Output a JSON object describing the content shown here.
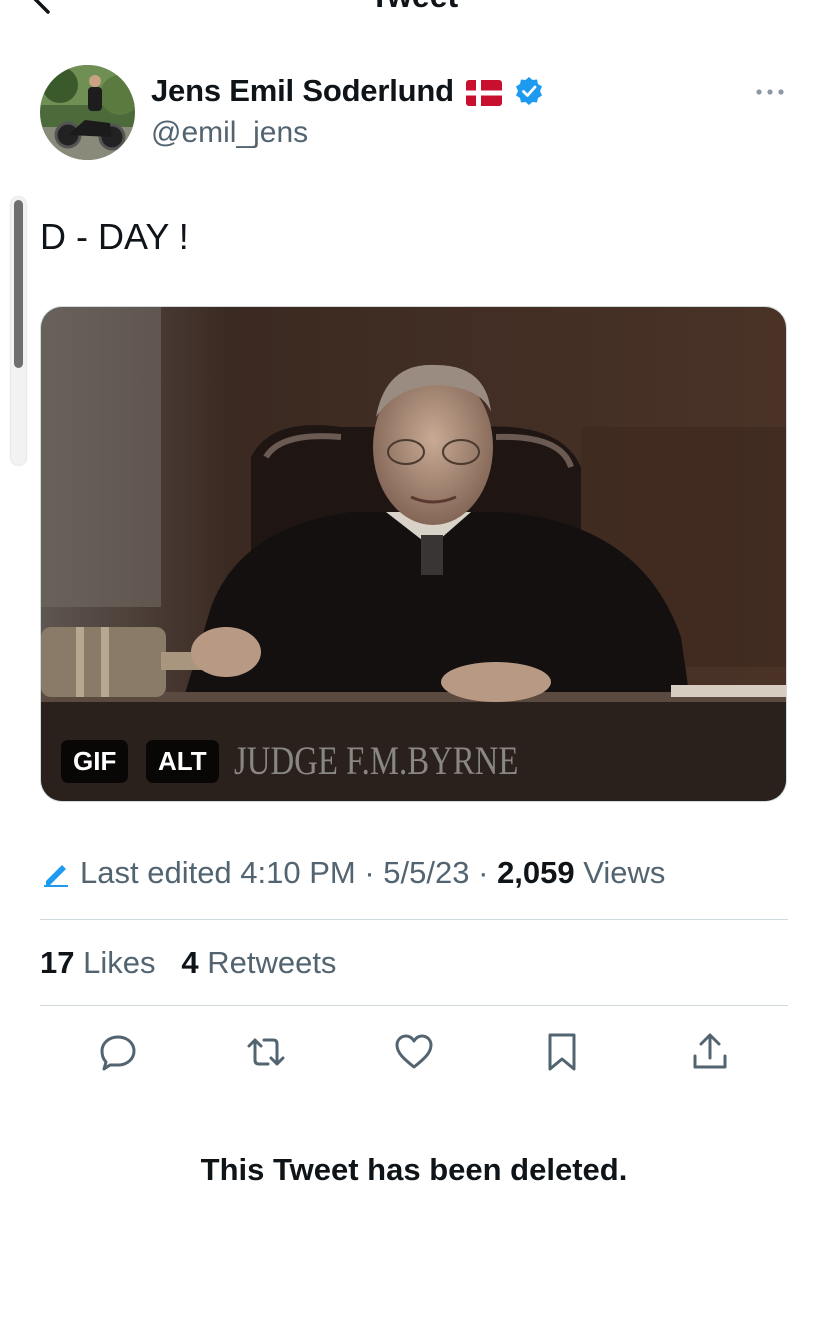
{
  "header": {
    "title": "Tweet"
  },
  "tweet": {
    "author": {
      "display_name": "Jens Emil Soderlund",
      "handle": "@emil_jens",
      "flag": "denmark-flag",
      "verified": true
    },
    "text": "D - DAY !",
    "media": {
      "badges": [
        "GIF",
        "ALT"
      ],
      "caption": "JUDGE F.M.BYRNE"
    },
    "meta": {
      "edited_label": "Last edited 4:10 PM",
      "date": "5/5/23",
      "views_count": "2,059",
      "views_label": "Views"
    },
    "stats": {
      "likes_count": "17",
      "likes_label": "Likes",
      "retweets_count": "4",
      "retweets_label": "Retweets"
    },
    "actions": [
      "reply-icon",
      "retweet-icon",
      "like-icon",
      "bookmark-icon",
      "share-icon"
    ]
  },
  "deleted_notice": "This Tweet has been deleted.",
  "colors": {
    "accent": "#1d9bf0",
    "secondary_text": "#536471",
    "divider": "#cfd9de"
  }
}
